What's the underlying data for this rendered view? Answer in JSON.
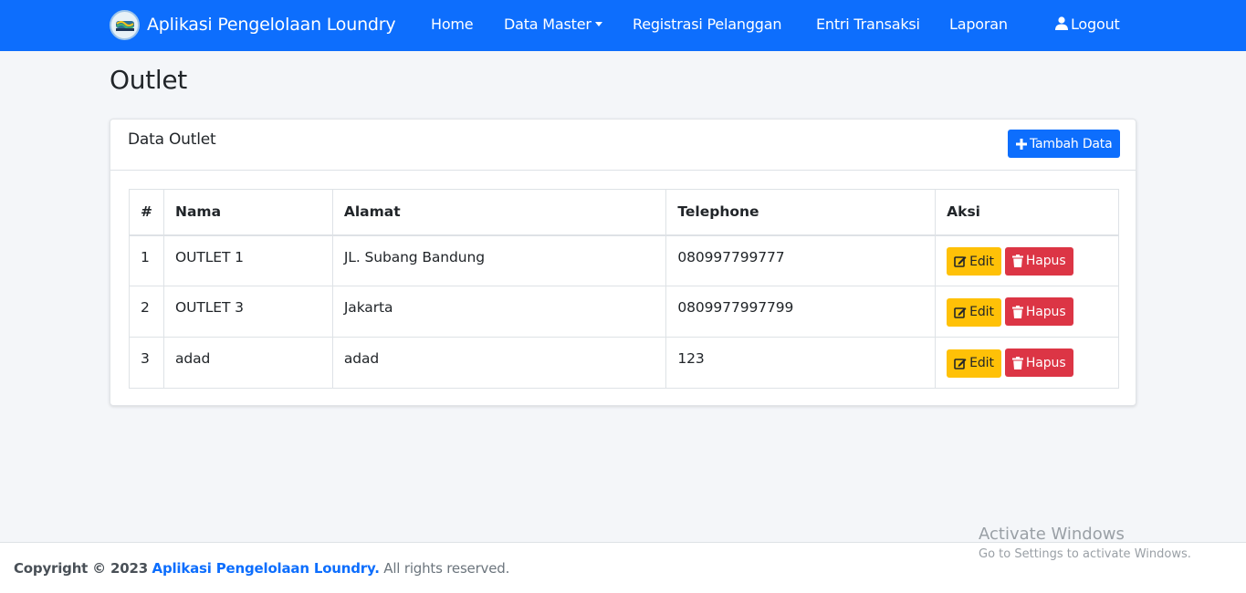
{
  "navbar": {
    "brand": "Aplikasi Pengelolaan Loundry",
    "items": [
      {
        "label": "Home"
      },
      {
        "label": "Data Master"
      },
      {
        "label": "Registrasi Pelanggan"
      },
      {
        "label": "Entri Transaksi"
      },
      {
        "label": "Laporan"
      }
    ],
    "logout": "Logout",
    "color": "#0d6efd"
  },
  "page": {
    "title": "Outlet"
  },
  "card": {
    "title": "Data Outlet",
    "add_button": "Tambah Data"
  },
  "table": {
    "headers": [
      "#",
      "Nama",
      "Alamat",
      "Telephone",
      "Aksi"
    ],
    "rows": [
      {
        "no": "1",
        "nama": "OUTLET 1",
        "alamat": "JL. Subang Bandung",
        "telephone": "080997799777"
      },
      {
        "no": "2",
        "nama": "OUTLET 3",
        "alamat": "Jakarta",
        "telephone": "0809977997799"
      },
      {
        "no": "3",
        "nama": "adad",
        "alamat": "adad",
        "telephone": "123"
      }
    ],
    "edit_label": "Edit",
    "delete_label": "Hapus"
  },
  "watermark": {
    "line1": "Activate Windows",
    "line2": "Go to Settings to activate Windows."
  },
  "footer": {
    "prefix": "Copyright © 2023",
    "link": "Aplikasi Pengelolaan Loundry.",
    "suffix": "All rights reserved."
  },
  "colors": {
    "primary": "#0d6efd",
    "warning": "#ffc107",
    "danger": "#dc3545",
    "background": "#f4f6f9"
  }
}
